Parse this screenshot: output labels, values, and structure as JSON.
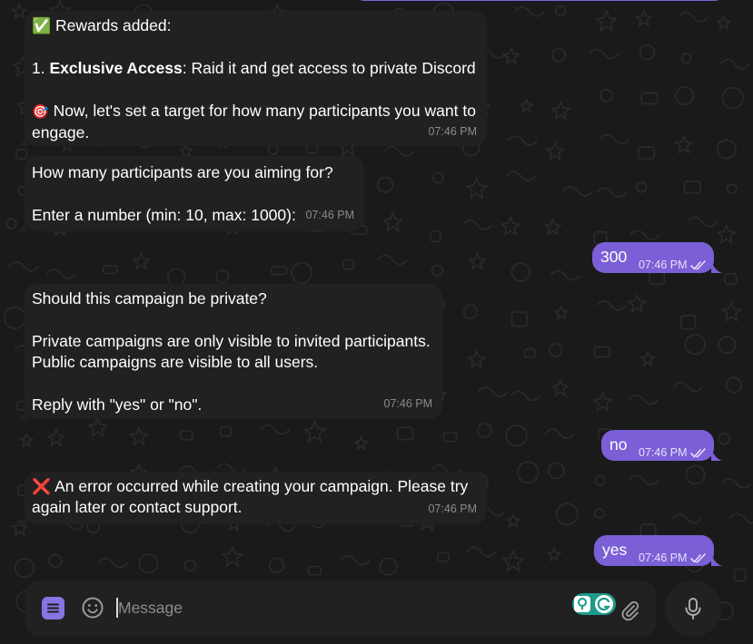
{
  "messages": [
    {
      "direction": "incoming",
      "emoji": "✅",
      "line1": "Rewards added:",
      "reward_number": "1. ",
      "reward_title": "Exclusive Access",
      "reward_desc": ": Raid it and get access to private Discord",
      "emoji2": "🎯",
      "line3": "Now, let's set a target for how many participants you want to engage.",
      "time": "07:46 PM"
    },
    {
      "direction": "incoming",
      "text_line1": "How many participants are you aiming for?",
      "text_line2": "Enter a number (min: 10, max: 1000):",
      "time": "07:46 PM"
    },
    {
      "direction": "outgoing",
      "text": "300",
      "time": "07:46 PM",
      "status": "read"
    },
    {
      "direction": "incoming",
      "line1": "Should this campaign be private?",
      "line2": "Private campaigns are only visible to invited participants.",
      "line3": "Public campaigns are visible to all users.",
      "line4": "Reply with \"yes\" or \"no\".",
      "time": "07:46 PM"
    },
    {
      "direction": "outgoing",
      "text": "no",
      "time": "07:46 PM",
      "status": "read"
    },
    {
      "direction": "incoming",
      "emoji": "❌",
      "text": "An error occurred while creating your campaign. Please try again later or contact support.",
      "time": "07:46 PM"
    },
    {
      "direction": "outgoing",
      "text": "yes",
      "time": "07:46 PM",
      "status": "read"
    }
  ],
  "composer": {
    "placeholder": "Message",
    "icons": [
      "bot-menu-icon",
      "emoji-icon",
      "grammarly-extension-icon",
      "attach-icon",
      "microphone-icon"
    ]
  },
  "colors": {
    "background": "#1a1a1a",
    "incoming_bubble": "#212121",
    "outgoing_bubble": "#7b5fd6",
    "accent": "#8774e1"
  }
}
